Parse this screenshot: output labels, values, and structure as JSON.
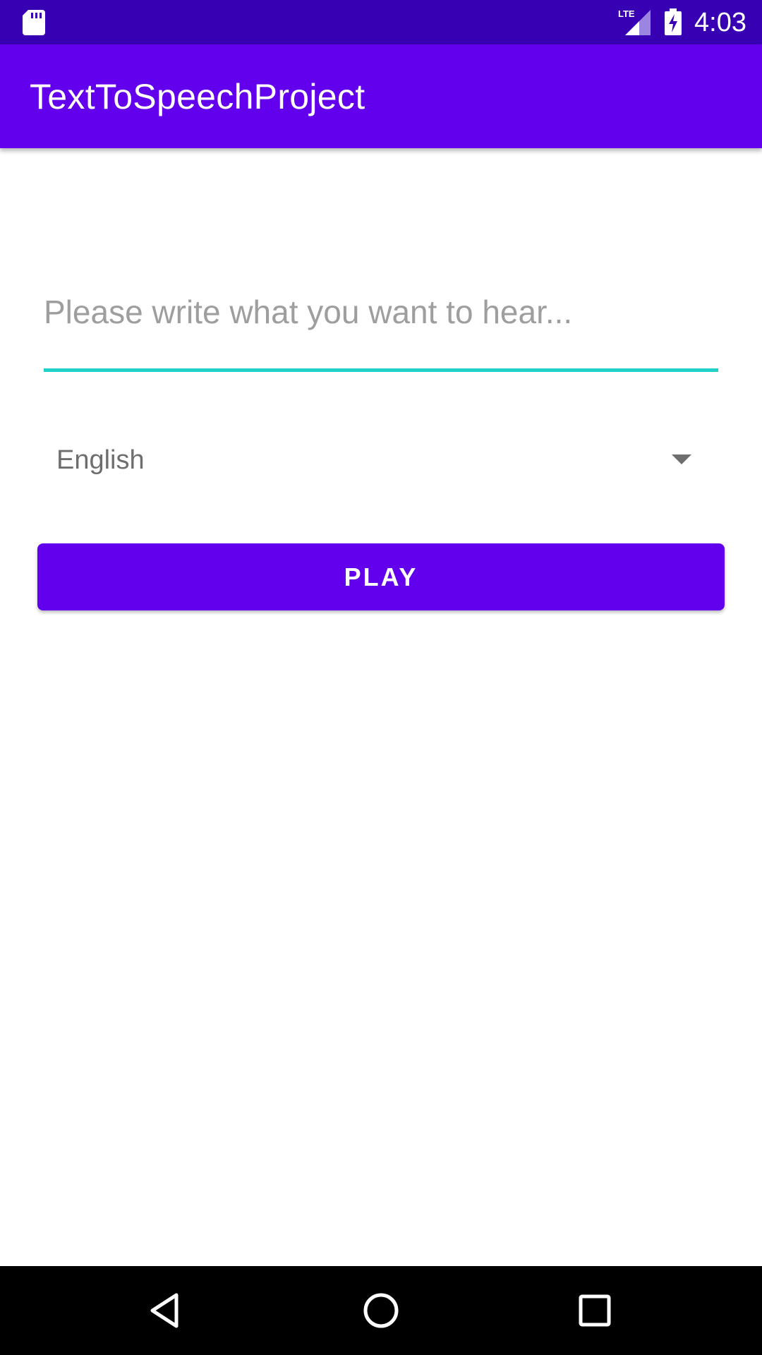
{
  "status_bar": {
    "time": "4:03",
    "network_label": "LTE",
    "icons": [
      "sd-card-icon",
      "lte-signal-icon",
      "battery-charging-icon"
    ]
  },
  "app_bar": {
    "title": "TextToSpeechProject"
  },
  "text_input": {
    "value": "",
    "placeholder": "Please write what you want to hear..."
  },
  "language_spinner": {
    "selected": "English",
    "icon": "dropdown-arrow-icon"
  },
  "play_button": {
    "label": "PLAY"
  },
  "nav_bar": {
    "icons": [
      "back-icon",
      "home-icon",
      "recents-icon"
    ]
  },
  "colors": {
    "status_bar": "#3700b3",
    "primary": "#6200ee",
    "accent_underline": "#1fd1c8",
    "background": "#ffffff",
    "nav_bar": "#000000"
  }
}
